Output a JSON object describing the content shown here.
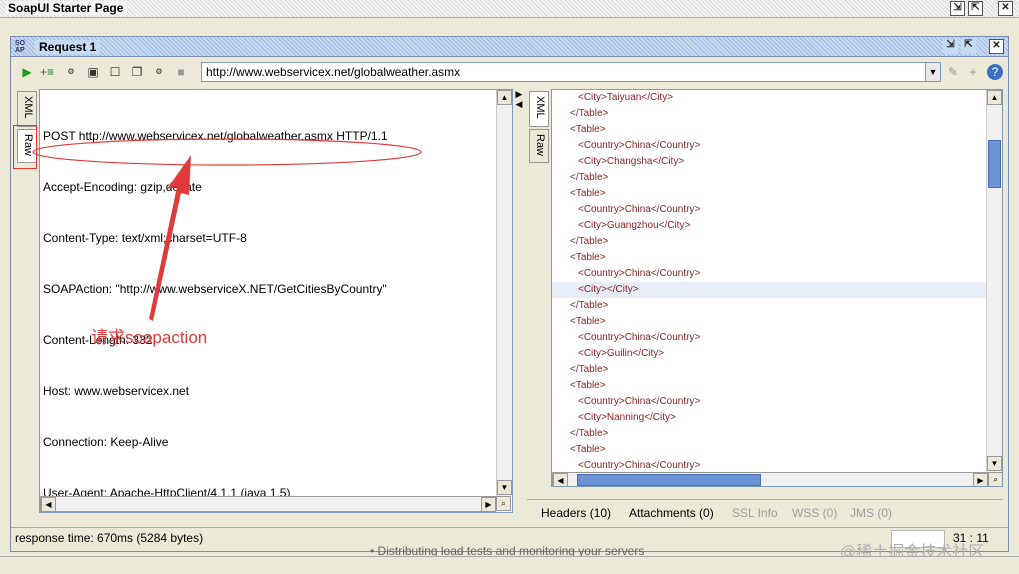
{
  "window": {
    "title": "SoapUI Starter Page"
  },
  "request_panel": {
    "title": "Request 1",
    "url": "http://www.webservicex.net/globalweather.asmx"
  },
  "left_editor": {
    "tabs": [
      "XML",
      "Raw"
    ],
    "lines": [
      "POST http://www.webservicex.net/globalweather.asmx HTTP/1.1",
      "Accept-Encoding: gzip,deflate",
      "Content-Type: text/xml;charset=UTF-8",
      "SOAPAction: \"http://www.webserviceX.NET/GetCitiesByCountry\"",
      "Content-Length: 332",
      "Host: www.webservicex.net",
      "Connection: Keep-Alive",
      "User-Agent: Apache-HttpClient/4.1.1 (java 1.5)"
    ]
  },
  "annotation": {
    "text": "请求soapaction",
    "color": "#e03a3a"
  },
  "right_editor": {
    "tabs": [
      "XML",
      "Raw"
    ],
    "xml_lines": [
      {
        "text": "<City>Taiyuan</City>",
        "indent": true
      },
      {
        "text": "</Table>",
        "indent": false
      },
      {
        "text": "<Table>",
        "indent": false
      },
      {
        "text": "<Country>China</Country>",
        "indent": true
      },
      {
        "text": "<City>Changsha</City>",
        "indent": true
      },
      {
        "text": "</Table>",
        "indent": false
      },
      {
        "text": "<Table>",
        "indent": false
      },
      {
        "text": "<Country>China</Country>",
        "indent": true
      },
      {
        "text": "<City>Guangzhou</City>",
        "indent": true
      },
      {
        "text": "</Table>",
        "indent": false
      },
      {
        "text": "<Table>",
        "indent": false
      },
      {
        "text": "<Country>China</Country>",
        "indent": true
      },
      {
        "text": "<City></City>",
        "indent": true,
        "highlight": true
      },
      {
        "text": "</Table>",
        "indent": false
      },
      {
        "text": "<Table>",
        "indent": false
      },
      {
        "text": "<Country>China</Country>",
        "indent": true
      },
      {
        "text": "<City>Guilin</City>",
        "indent": true
      },
      {
        "text": "</Table>",
        "indent": false
      },
      {
        "text": "<Table>",
        "indent": false
      },
      {
        "text": "<Country>China</Country>",
        "indent": true
      },
      {
        "text": "<City>Nanning</City>",
        "indent": true
      },
      {
        "text": "</Table>",
        "indent": false
      },
      {
        "text": "<Table>",
        "indent": false
      },
      {
        "text": "<Country>China</Country>",
        "indent": true
      }
    ],
    "bottom_tabs": [
      {
        "label": "Headers (10)",
        "enabled": true
      },
      {
        "label": "Attachments (0)",
        "enabled": true
      },
      {
        "label": "SSL Info",
        "enabled": false
      },
      {
        "label": "WSS (0)",
        "enabled": false
      },
      {
        "label": "JMS (0)",
        "enabled": false
      }
    ]
  },
  "status": {
    "response_time": "response time: 670ms (5284 bytes)",
    "cursor": "31 : 11"
  },
  "background_text": "•   Distributing load tests and monitoring your servers",
  "watermark": "@稀土掘金技术社区",
  "colors": {
    "annotation_red": "#e03a3a",
    "xml_tag": "#8b1e1e",
    "panel_blue": "#c9dbf3"
  }
}
